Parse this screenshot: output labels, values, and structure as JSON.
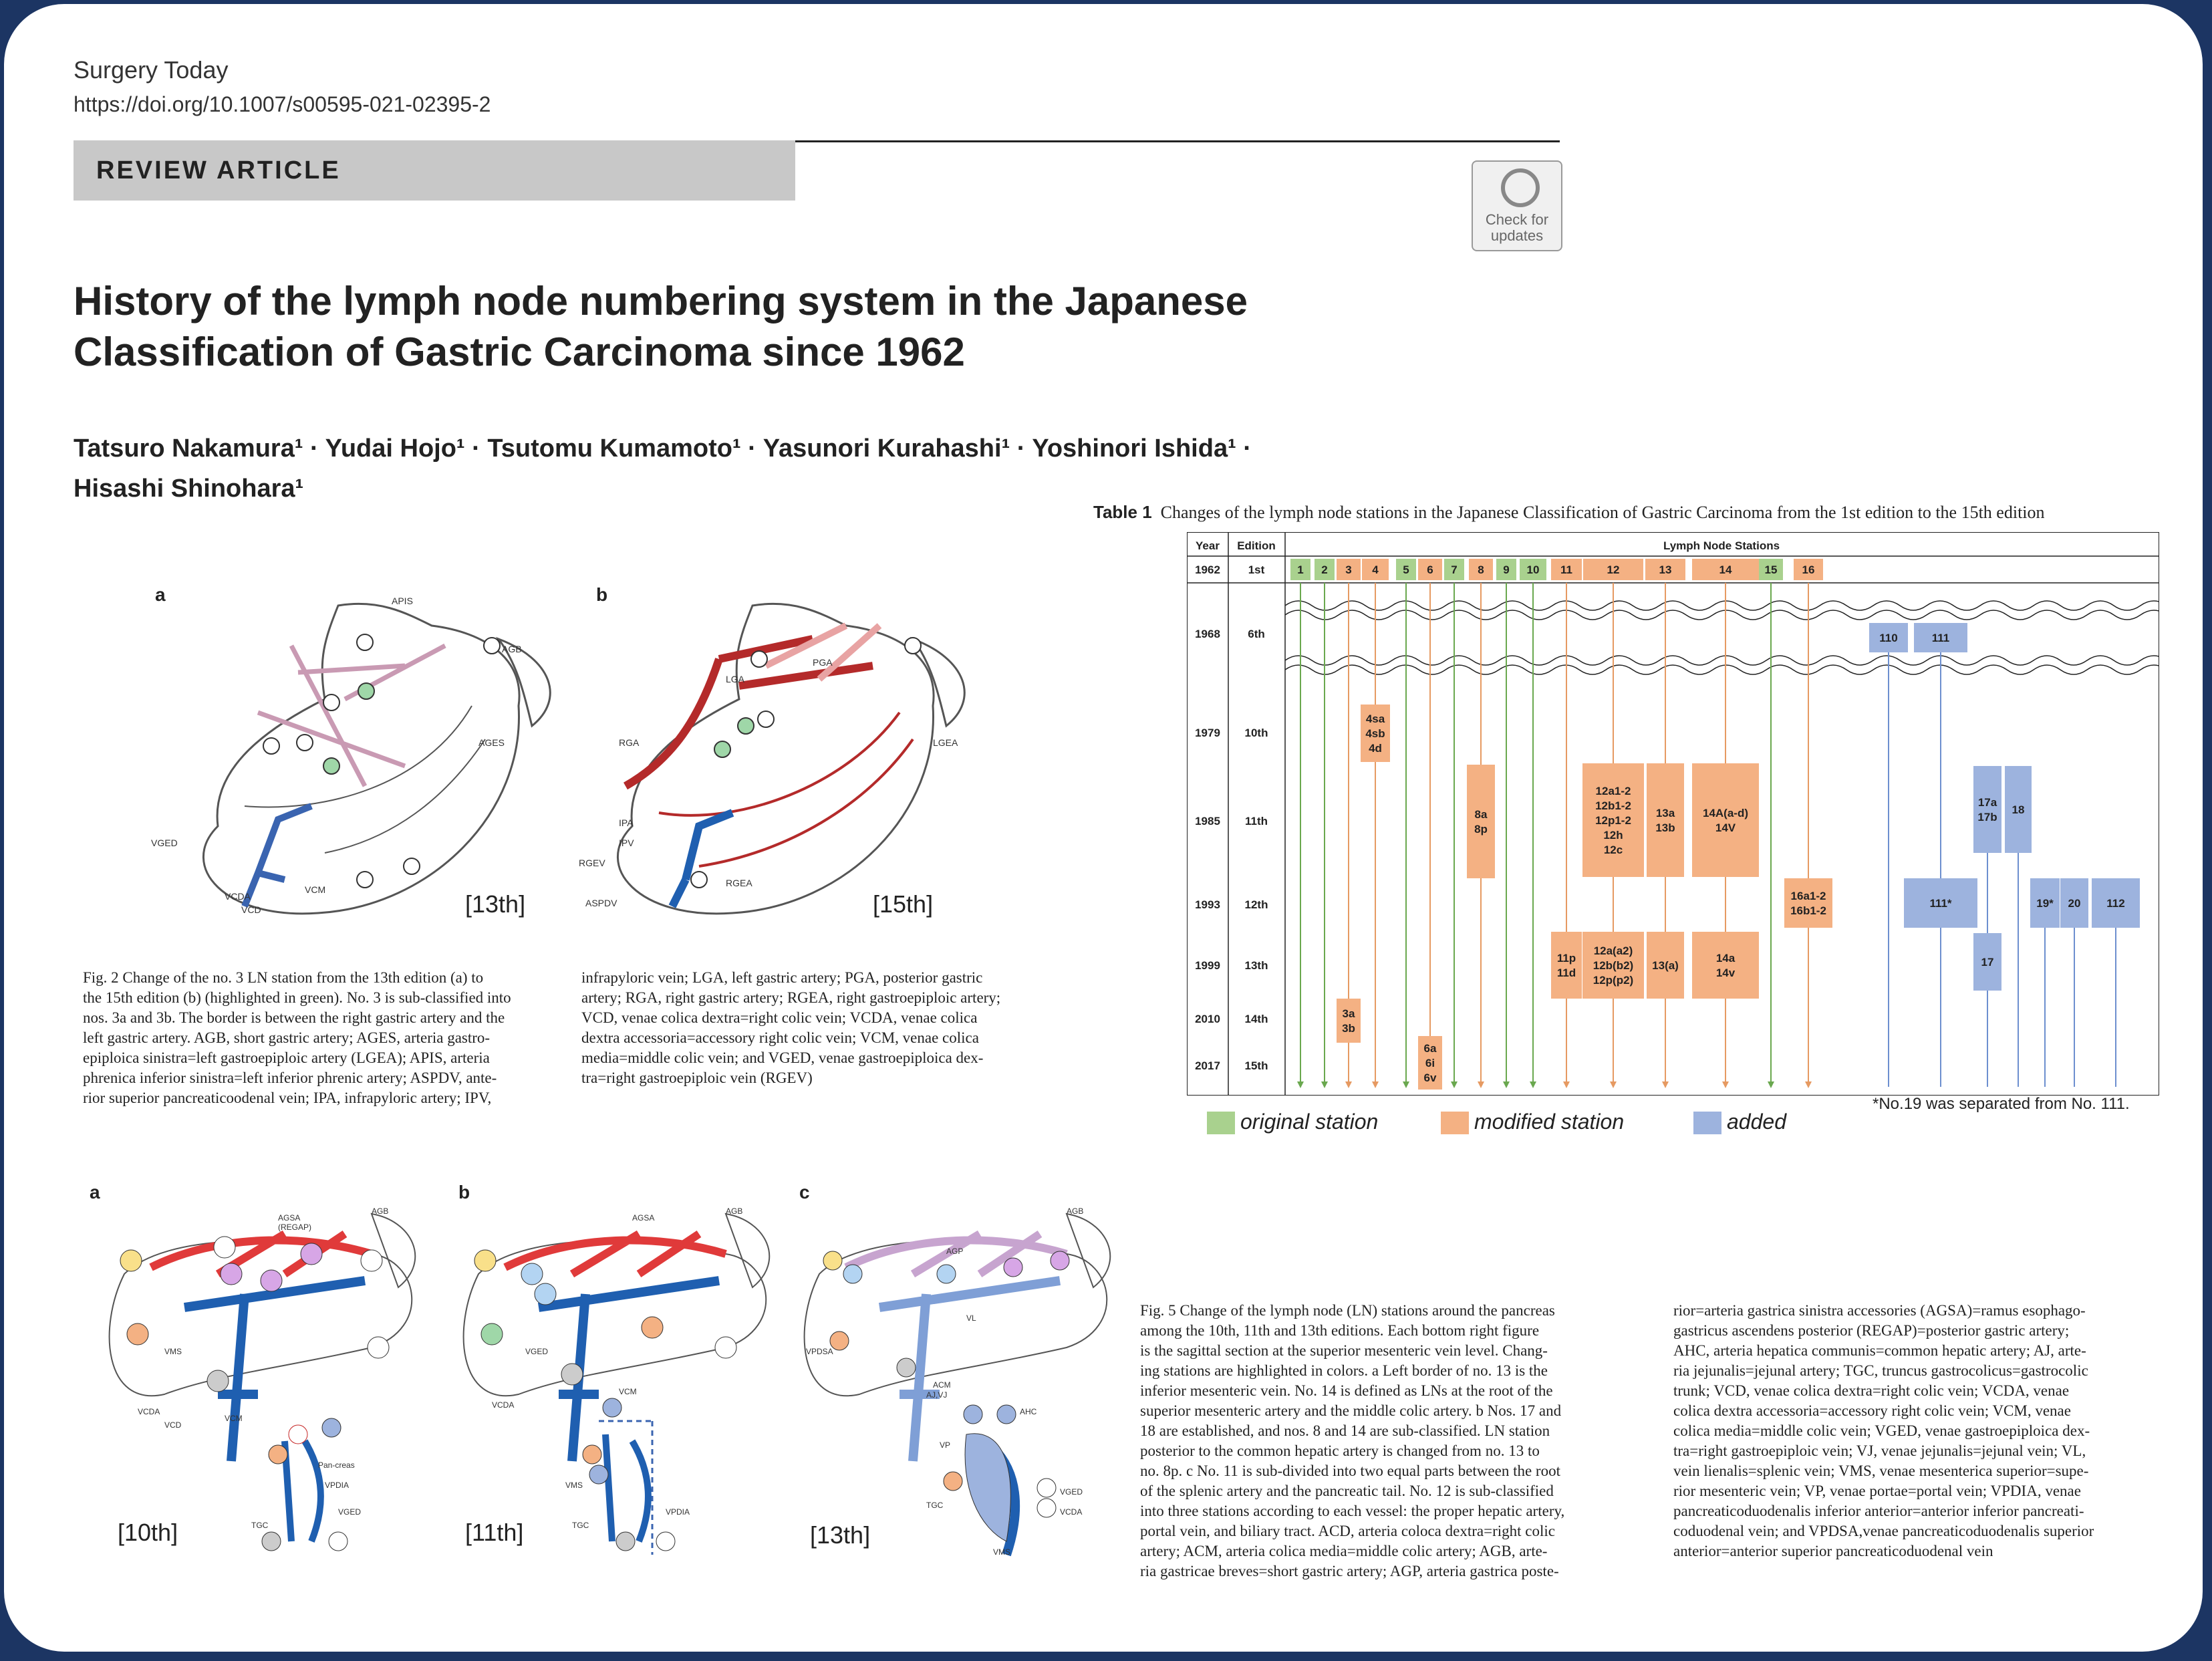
{
  "header": {
    "journal": "Surgery Today",
    "doi": "https://doi.org/10.1007/s00595-021-02395-2",
    "article_type": "REVIEW ARTICLE",
    "check_updates": [
      "Check for",
      "updates"
    ]
  },
  "title_lines": [
    "History of the lymph node numbering system in the Japanese",
    "Classification of Gastric Carcinoma since 1962"
  ],
  "authors_lines": [
    "Tatsuro Nakamura¹ · Yudai Hojo¹ · Tsutomu Kumamoto¹ · Yasunori Kurahashi¹ · Yoshinori Ishida¹ ·",
    "Hisashi Shinohara¹"
  ],
  "fig2": {
    "panel_a": "a",
    "panel_b": "b",
    "edition_a": "[13th]",
    "edition_b": "[15th]",
    "labels_a": [
      "APIS",
      "AGB",
      "AGES",
      "VGED",
      "VCDA",
      "VCD",
      "VCM"
    ],
    "labels_b": [
      "LGA",
      "PGA",
      "RGA",
      "LGEA",
      "IPA",
      "IPV",
      "RGEV",
      "ASPDV",
      "RGEA"
    ],
    "caption_left": [
      "Fig. 2  Change of the no. 3 LN station from the 13th edition (a) to",
      "the 15th edition (b) (highlighted in green). No. 3 is sub-classified into",
      "nos. 3a and 3b. The border is between the right gastric artery and the",
      "left gastric artery. AGB, short gastric artery; AGES, arteria gastro-",
      "epiploica sinistra=left gastroepiploic artery (LGEA); APIS, arteria",
      "phrenica inferior sinistra=left inferior phrenic artery; ASPDV, ante-",
      "rior superior pancreaticoodenal vein; IPA, infrapyloric artery; IPV,"
    ],
    "caption_right": [
      "infrapyloric vein; LGA, left gastric artery; PGA, posterior gastric",
      "artery; RGA, right gastric artery; RGEA, right gastroepiploic artery;",
      "VCD, venae colica dextra=right colic vein; VCDA, venae colica",
      "dextra accessoria=accessory right colic vein; VCM, venae colica",
      "media=middle colic vein; and VGED, venae gastroepiploica dex-",
      "tra=right gastroepiploic vein (RGEV)"
    ]
  },
  "table1": {
    "caption_label": "Table 1",
    "caption": "Changes of the lymph node stations in the Japanese Classification of Gastric Carcinoma from the 1st edition to the 15th edition",
    "headers": [
      "Year",
      "Edition",
      "Lymph Node Stations"
    ],
    "rows": [
      {
        "year": "1962",
        "edition": "1st"
      },
      {
        "year": "1968",
        "edition": "6th"
      },
      {
        "year": "1979",
        "edition": "10th"
      },
      {
        "year": "1985",
        "edition": "11th"
      },
      {
        "year": "1993",
        "edition": "12th"
      },
      {
        "year": "1999",
        "edition": "13th"
      },
      {
        "year": "2010",
        "edition": "14th"
      },
      {
        "year": "2017",
        "edition": "15th"
      }
    ],
    "original_stations": [
      {
        "label": "1",
        "status": "original"
      },
      {
        "label": "2",
        "status": "original"
      },
      {
        "label": "3",
        "status": "modified"
      },
      {
        "label": "4",
        "status": "modified"
      },
      {
        "label": "5",
        "status": "original"
      },
      {
        "label": "6",
        "status": "modified"
      },
      {
        "label": "7",
        "status": "original"
      },
      {
        "label": "8",
        "status": "modified"
      },
      {
        "label": "9",
        "status": "original"
      },
      {
        "label": "10",
        "status": "original"
      },
      {
        "label": "11",
        "status": "modified"
      },
      {
        "label": "12",
        "status": "modified"
      },
      {
        "label": "13",
        "status": "modified"
      },
      {
        "label": "14",
        "status": "modified"
      },
      {
        "label": "15",
        "status": "original"
      },
      {
        "label": "16",
        "status": "modified"
      }
    ],
    "changes": [
      {
        "edition": "6th",
        "lines": [
          "110"
        ],
        "status": "added"
      },
      {
        "edition": "6th",
        "lines": [
          "111"
        ],
        "status": "added"
      },
      {
        "edition": "10th",
        "lines": [
          "4sa",
          "4sb",
          "4d"
        ],
        "status": "modified"
      },
      {
        "edition": "11th",
        "lines": [
          "8a",
          "8p"
        ],
        "status": "modified"
      },
      {
        "edition": "11th",
        "lines": [
          "12a1-2",
          "12b1-2",
          "12p1-2",
          "12h",
          "12c"
        ],
        "status": "modified"
      },
      {
        "edition": "11th",
        "lines": [
          "13a",
          "13b"
        ],
        "status": "modified"
      },
      {
        "edition": "11th",
        "lines": [
          "14A(a-d)",
          "14V"
        ],
        "status": "modified"
      },
      {
        "edition": "11th",
        "lines": [
          "17a",
          "17b"
        ],
        "status": "added"
      },
      {
        "edition": "11th",
        "lines": [
          "18"
        ],
        "status": "added"
      },
      {
        "edition": "12th",
        "lines": [
          "16a1-2",
          "16b1-2"
        ],
        "status": "modified"
      },
      {
        "edition": "12th",
        "lines": [
          "111*"
        ],
        "status": "added"
      },
      {
        "edition": "12th",
        "lines": [
          "19*"
        ],
        "status": "added"
      },
      {
        "edition": "12th",
        "lines": [
          "20"
        ],
        "status": "added"
      },
      {
        "edition": "12th",
        "lines": [
          "112"
        ],
        "status": "added"
      },
      {
        "edition": "13th",
        "lines": [
          "11p",
          "11d"
        ],
        "status": "modified"
      },
      {
        "edition": "13th",
        "lines": [
          "12a(a2)",
          "12b(b2)",
          "12p(p2)"
        ],
        "status": "modified"
      },
      {
        "edition": "13th",
        "lines": [
          "13(a)"
        ],
        "status": "modified"
      },
      {
        "edition": "13th",
        "lines": [
          "14a",
          "14v"
        ],
        "status": "modified"
      },
      {
        "edition": "13th",
        "lines": [
          "17"
        ],
        "status": "added"
      },
      {
        "edition": "14th",
        "lines": [
          "3a",
          "3b"
        ],
        "status": "modified"
      },
      {
        "edition": "15th",
        "lines": [
          "6a",
          "6i",
          "6v"
        ],
        "status": "modified"
      }
    ],
    "legend": [
      {
        "label": "original station",
        "color": "#a9d18e"
      },
      {
        "label": "modified station",
        "color": "#f4b183"
      },
      {
        "label": "added",
        "color": "#9db3de"
      }
    ],
    "footnote": "*No.19 was separated from No. 111."
  },
  "fig5": {
    "panel_a": "a",
    "panel_b": "b",
    "panel_c": "c",
    "edition_a": "[10th]",
    "edition_b": "[11th]",
    "edition_c": "[13th]",
    "caption_left": [
      "Fig. 5  Change of the lymph node (LN) stations around the pancreas",
      "among the 10th, 11th and 13th editions. Each bottom right figure",
      "is the sagittal section at the superior mesenteric vein level. Chang-",
      "ing stations are highlighted in colors. a Left border of no. 13 is the",
      "inferior mesenteric vein. No. 14 is defined as LNs at the root of the",
      "superior mesenteric artery and the middle colic artery. b Nos. 17 and",
      "18 are established, and nos. 8 and 14 are sub-classified. LN station",
      "posterior to the common hepatic artery is changed from no. 13 to",
      "no. 8p. c No. 11 is sub-divided into two equal parts between the root",
      "of the splenic artery and the pancreatic tail. No. 12 is sub-classified",
      "into three stations according to each vessel: the proper hepatic artery,",
      "portal vein, and biliary tract. ACD, arteria coloca dextra=right colic",
      "artery; ACM, arteria colica media=middle colic artery; AGB, arte-",
      "ria gastricae breves=short gastric artery; AGP, arteria gastrica poste-"
    ],
    "caption_right": [
      "rior=arteria gastrica sinistra accessories (AGSA)=ramus esophago-",
      "gastricus ascendens posterior (REGAP)=posterior gastric artery;",
      "AHC, arteria hepatica communis=common hepatic artery; AJ, arte-",
      "ria jejunalis=jejunal artery; TGC, truncus gastrocolicus=gastrocolic",
      "trunk; VCD, venae colica dextra=right colic vein; VCDA, venae",
      "colica dextra accessoria=accessory right colic vein; VCM, venae",
      "colica media=middle colic vein; VGED, venae gastroepiploica dex-",
      "tra=right gastroepiploic vein; VJ, venae jejunalis=jejunal vein; VL,",
      "vein lienalis=splenic vein; VMS, venae mesenterica superior=supe-",
      "rior mesenteric vein; VP, venae portae=portal vein; VPDIA, venae",
      "pancreaticoduodenalis inferior anterior=anterior inferior pancreati-",
      "coduodenal vein; and VPDSA,venae pancreaticoduodenalis superior",
      "anterior=anterior superior pancreaticoduodenal vein"
    ],
    "labels": [
      "AGSA",
      "(REGAP)",
      "AGB",
      "AGP",
      "VMS",
      "VCD",
      "VCM",
      "VCDA",
      "TGC",
      "VGED",
      "VPDIA",
      "VPDSA",
      "AHC",
      "VL",
      "VP",
      "ACM",
      "AJ,VJ",
      "Pan-creas"
    ]
  },
  "colors": {
    "original": "#a9d18e",
    "modified": "#f4b183",
    "added": "#9db3de",
    "frame": "#1c3563",
    "artery": "#c62828",
    "vein": "#1f5fb0"
  }
}
